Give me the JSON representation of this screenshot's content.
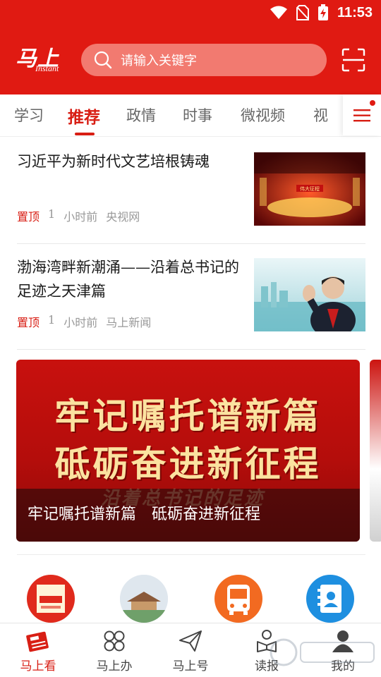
{
  "status_bar": {
    "time": "11:53"
  },
  "app": {
    "logo_text": "马上",
    "logo_subtext": "Instant"
  },
  "search": {
    "placeholder": "请输入关键字"
  },
  "tabs": [
    {
      "label": "学习",
      "active": false
    },
    {
      "label": "推荐",
      "active": true
    },
    {
      "label": "政情",
      "active": false
    },
    {
      "label": "时事",
      "active": false
    },
    {
      "label": "微视频",
      "active": false
    },
    {
      "label": "视",
      "active": false
    }
  ],
  "news": [
    {
      "title": "习近平为新时代文艺培根铸魂",
      "pin": "置顶",
      "comments": "1",
      "time": "小时前",
      "source": "央视网"
    },
    {
      "title": "渤海湾畔新潮涌——沿着总书记的足迹之天津篇",
      "pin": "置顶",
      "comments": "1",
      "time": "小时前",
      "source": "马上新闻"
    }
  ],
  "banner": {
    "line1": "牢记嘱托谱新篇",
    "line2": "砥砺奋进新征程",
    "subline": "沿着总书记的足迹",
    "caption": "牢记嘱托谱新篇　砥砺奋进新征程"
  },
  "thumb1_text": "伟大征程",
  "services": [
    {
      "icon": "mashangban-promo-icon",
      "color": "#e02a1c"
    },
    {
      "icon": "pavilion-photo-icon",
      "color": "#d0d8e0"
    },
    {
      "icon": "bus-icon",
      "color": "#f26a21"
    },
    {
      "icon": "contacts-book-icon",
      "color": "#1e8fe0"
    }
  ],
  "bottom_nav": [
    {
      "label": "马上看",
      "icon": "newspaper-icon",
      "active": true
    },
    {
      "label": "马上办",
      "icon": "grid-clover-icon",
      "active": false
    },
    {
      "label": "马上号",
      "icon": "paper-plane-icon",
      "active": false
    },
    {
      "label": "读报",
      "icon": "book-reader-icon",
      "active": false
    },
    {
      "label": "我的",
      "icon": "user-profile-icon",
      "active": false
    }
  ],
  "colors": {
    "brand_red": "#e01a12",
    "accent_red": "#d81e14",
    "search_bg": "#f27a70"
  }
}
